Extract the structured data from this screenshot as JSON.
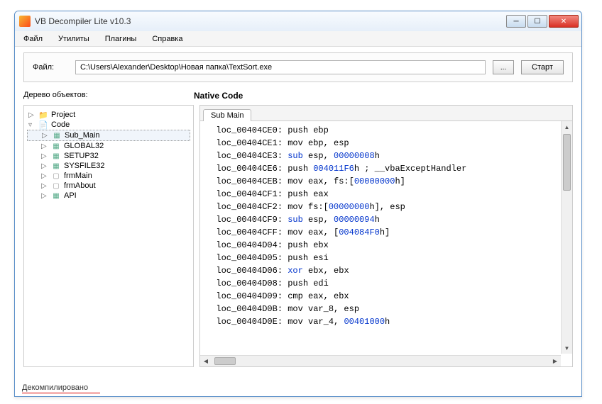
{
  "title": "VB Decompiler Lite v10.3",
  "menu": {
    "file": "Файл",
    "utils": "Утилиты",
    "plugins": "Плагины",
    "help": "Справка"
  },
  "fileBar": {
    "label": "Файл:",
    "path": "C:\\Users\\Alexander\\Desktop\\Новая папка\\TextSort.exe",
    "browse": "...",
    "start": "Старт"
  },
  "treeHeader": "Дерево объектов:",
  "codeHeader": "Native Code",
  "tree": {
    "project": "Project",
    "code": "Code",
    "items": [
      "Sub_Main",
      "GLOBAL32",
      "SETUP32",
      "SYSFILE32",
      "frmMain",
      "frmAbout",
      "API"
    ]
  },
  "tab": "Sub Main",
  "codeLines": [
    {
      "addr": "loc_00404CE0",
      "op": "push",
      "args": "ebp"
    },
    {
      "addr": "loc_00404CE1",
      "op": "mov",
      "args": "ebp, esp"
    },
    {
      "addr": "loc_00404CE3",
      "op": "sub",
      "args": "esp, ",
      "num": "00000008",
      "suffix": "h",
      "kw": true
    },
    {
      "addr": "loc_00404CE6",
      "op": "push ",
      "num": "004011F6",
      "suffix": "h ; __vbaExceptHandler"
    },
    {
      "addr": "loc_00404CEB",
      "op": "mov",
      "args": "eax, fs:[",
      "num": "00000000",
      "suffix": "h]"
    },
    {
      "addr": "loc_00404CF1",
      "op": "push",
      "args": "eax"
    },
    {
      "addr": "loc_00404CF2",
      "op": "mov",
      "args": "fs:[",
      "num": "00000000",
      "suffix": "h], esp"
    },
    {
      "addr": "loc_00404CF9",
      "op": "sub",
      "args": "esp, ",
      "num": "00000094",
      "suffix": "h",
      "kw": true
    },
    {
      "addr": "loc_00404CFF",
      "op": "mov",
      "args": "eax, [",
      "num": "004084F0",
      "suffix": "h]"
    },
    {
      "addr": "loc_00404D04",
      "op": "push",
      "args": "ebx"
    },
    {
      "addr": "loc_00404D05",
      "op": "push",
      "args": "esi"
    },
    {
      "addr": "loc_00404D06",
      "op": "xor",
      "args": "ebx, ebx",
      "kw": true
    },
    {
      "addr": "loc_00404D08",
      "op": "push",
      "args": "edi"
    },
    {
      "addr": "loc_00404D09",
      "op": "cmp",
      "args": "eax, ebx"
    },
    {
      "addr": "loc_00404D0B",
      "op": "mov",
      "args": "var_8, esp"
    },
    {
      "addr": "loc_00404D0E",
      "op": "mov",
      "args": "var_4, ",
      "num": "00401000",
      "suffix": "h"
    }
  ],
  "status": "Декомпилировано"
}
